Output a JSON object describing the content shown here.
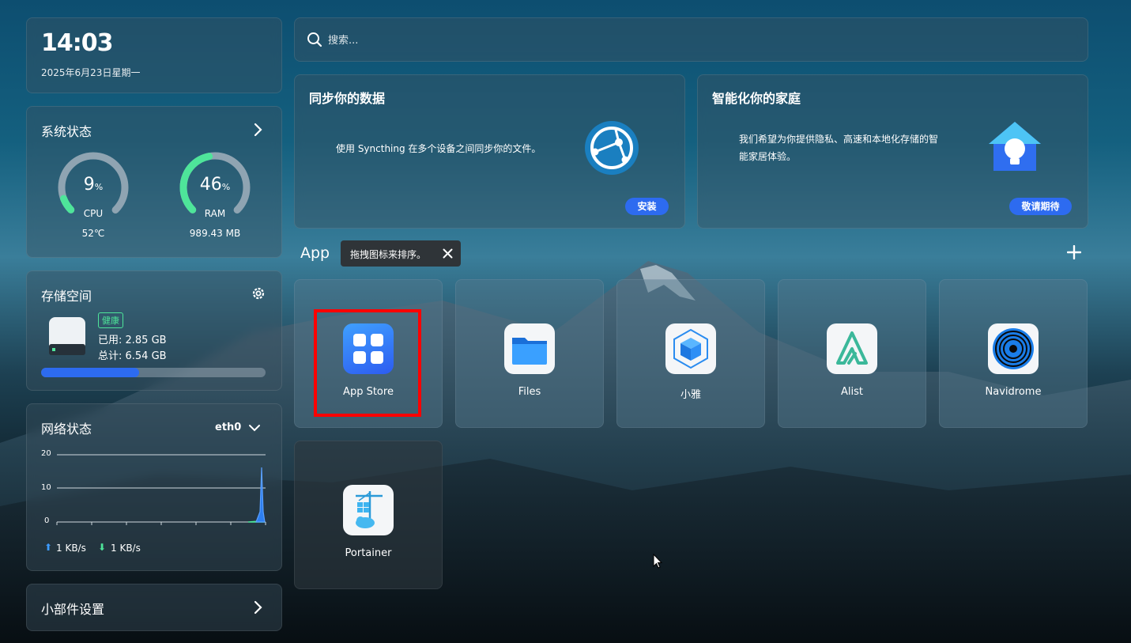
{
  "clock": {
    "time": "14:03",
    "date": "2025年6月23日星期一"
  },
  "system": {
    "title": "系统状态",
    "cpu": {
      "value": "9",
      "unit": "%",
      "label": "CPU",
      "temp": "52℃",
      "percent": 9
    },
    "ram": {
      "value": "46",
      "unit": "%",
      "label": "RAM",
      "used": "989.43 MB",
      "percent": 46
    }
  },
  "storage": {
    "title": "存储空间",
    "health": "健康",
    "used": "已用: 2.85 GB",
    "total": "总计: 6.54 GB",
    "fill": 0.436
  },
  "network": {
    "title": "网络状态",
    "iface": "eth0",
    "y_ticks": [
      "20",
      "10",
      "0"
    ],
    "upload": "1 KB/s",
    "download": "1 KB/s"
  },
  "widget_settings": {
    "label": "小部件设置"
  },
  "search": {
    "placeholder": "搜索..."
  },
  "promo": [
    {
      "title": "同步你的数据",
      "desc": "使用 Syncthing 在多个设备之间同步你的文件。",
      "button": "安装"
    },
    {
      "title": "智能化你的家庭",
      "desc_line1": "我们希望为你提供隐私、高速和本地化存储的智",
      "desc_line2": "能家居体验。",
      "button": "敬请期待"
    }
  ],
  "apps_section": {
    "title": "App",
    "tooltip": "拖拽图标来排序。"
  },
  "apps": [
    {
      "name": "App Store",
      "icon": "app-store-icon"
    },
    {
      "name": "Files",
      "icon": "folder-icon"
    },
    {
      "name": "小雅",
      "icon": "cube-icon"
    },
    {
      "name": "Alist",
      "icon": "alist-icon"
    },
    {
      "name": "Navidrome",
      "icon": "vinyl-icon"
    },
    {
      "name": "Portainer",
      "icon": "portainer-icon"
    }
  ],
  "colors": {
    "accent": "#2d6bf0",
    "gauge": "#4ee59a",
    "highlight": "#ff0000"
  }
}
